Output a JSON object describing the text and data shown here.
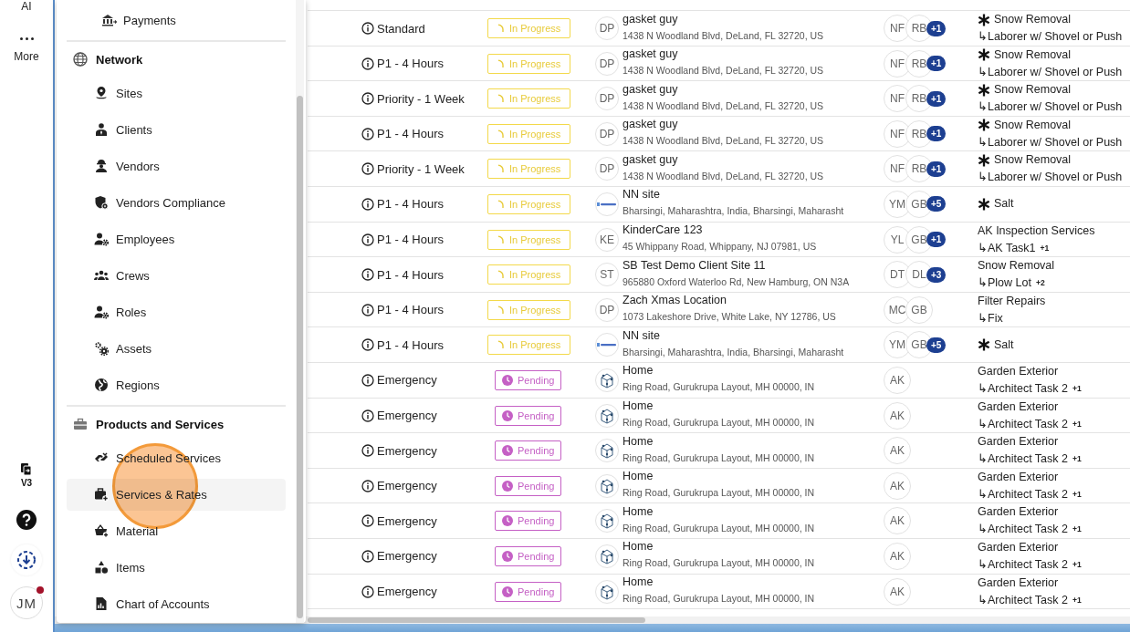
{
  "rail": {
    "items": [
      {
        "label": "AI",
        "kind": "ai"
      },
      {
        "label": "More",
        "kind": "more"
      }
    ],
    "version": "V3",
    "avatar": {
      "initials": "JM",
      "notification": true
    }
  },
  "menu": {
    "items": [
      {
        "label": "Payments",
        "selected": false
      }
    ],
    "sections": [
      {
        "title": "Network",
        "items": [
          {
            "label": "Sites",
            "selected": false
          },
          {
            "label": "Clients",
            "selected": false
          },
          {
            "label": "Vendors",
            "selected": false
          },
          {
            "label": "Vendors Compliance",
            "selected": false
          },
          {
            "label": "Employees",
            "selected": false
          },
          {
            "label": "Crews",
            "selected": false
          },
          {
            "label": "Roles",
            "selected": false
          },
          {
            "label": "Assets",
            "selected": false
          },
          {
            "label": "Regions",
            "selected": false
          }
        ]
      },
      {
        "title": "Products and Services",
        "items": [
          {
            "label": "Scheduled Services",
            "selected": false
          },
          {
            "label": "Services & Rates",
            "selected": true
          },
          {
            "label": "Material",
            "selected": false
          },
          {
            "label": "Items",
            "selected": false
          },
          {
            "label": "Chart of Accounts",
            "selected": false
          }
        ]
      }
    ]
  },
  "table": {
    "rows": [
      {
        "priority": "Standard",
        "status": {
          "label": "In Progress",
          "kind": "in_progress"
        },
        "site": {
          "kind": "initials",
          "initials": "DP",
          "name": "gasket guy",
          "address": "1438 N Woodland Blvd, DeLand, FL 32720, US"
        },
        "vendors": {
          "initials": [
            "NF",
            "RB"
          ],
          "extra": "+1"
        },
        "service": {
          "starred": true,
          "name": "Snow Removal",
          "task": "↳Laborer w/ Shovel or Push"
        }
      },
      {
        "priority": "P1 - 4 Hours",
        "status": {
          "label": "In Progress",
          "kind": "in_progress"
        },
        "site": {
          "kind": "initials",
          "initials": "DP",
          "name": "gasket guy",
          "address": "1438 N Woodland Blvd, DeLand, FL 32720, US"
        },
        "vendors": {
          "initials": [
            "NF",
            "RB"
          ],
          "extra": "+1"
        },
        "service": {
          "starred": true,
          "name": "Snow Removal",
          "task": "↳Laborer w/ Shovel or Push"
        }
      },
      {
        "priority": "Priority - 1 Week",
        "status": {
          "label": "In Progress",
          "kind": "in_progress"
        },
        "site": {
          "kind": "initials",
          "initials": "DP",
          "name": "gasket guy",
          "address": "1438 N Woodland Blvd, DeLand, FL 32720, US"
        },
        "vendors": {
          "initials": [
            "NF",
            "RB"
          ],
          "extra": "+1"
        },
        "service": {
          "starred": true,
          "name": "Snow Removal",
          "task": "↳Laborer w/ Shovel or Push"
        }
      },
      {
        "priority": "P1 - 4 Hours",
        "status": {
          "label": "In Progress",
          "kind": "in_progress"
        },
        "site": {
          "kind": "initials",
          "initials": "DP",
          "name": "gasket guy",
          "address": "1438 N Woodland Blvd, DeLand, FL 32720, US"
        },
        "vendors": {
          "initials": [
            "NF",
            "RB"
          ],
          "extra": "+1"
        },
        "service": {
          "starred": true,
          "name": "Snow Removal",
          "task": "↳Laborer w/ Shovel or Push"
        }
      },
      {
        "priority": "Priority - 1 Week",
        "status": {
          "label": "In Progress",
          "kind": "in_progress"
        },
        "site": {
          "kind": "initials",
          "initials": "DP",
          "name": "gasket guy",
          "address": "1438 N Woodland Blvd, DeLand, FL 32720, US"
        },
        "vendors": {
          "initials": [
            "NF",
            "RB"
          ],
          "extra": "+1"
        },
        "service": {
          "starred": true,
          "name": "Snow Removal",
          "task": "↳Laborer w/ Shovel or Push"
        }
      },
      {
        "priority": "P1 - 4 Hours",
        "status": {
          "label": "In Progress",
          "kind": "in_progress"
        },
        "site": {
          "kind": "brand",
          "name": "NN site",
          "address": "Bharsingi, Maharashtra, India, Bharsingi, Maharasht"
        },
        "vendors": {
          "initials": [
            "YM",
            "GB"
          ],
          "extra": "+5"
        },
        "service": {
          "starred": true,
          "name": "Salt"
        }
      },
      {
        "priority": "P1 - 4 Hours",
        "status": {
          "label": "In Progress",
          "kind": "in_progress"
        },
        "site": {
          "kind": "initials",
          "initials": "KE",
          "name": "KinderCare 123",
          "address": "45 Whippany Road, Whippany, NJ 07981, US"
        },
        "vendors": {
          "initials": [
            "YL",
            "GB"
          ],
          "extra": "+1"
        },
        "service": {
          "starred": false,
          "name": "AK Inspection Services",
          "task": "↳AK Task1",
          "more": "+1"
        }
      },
      {
        "priority": "P1 - 4 Hours",
        "status": {
          "label": "In Progress",
          "kind": "in_progress"
        },
        "site": {
          "kind": "initials",
          "initials": "ST",
          "name": "SB Test Demo Client Site 11",
          "address": "965880 Oxford Waterloo Rd, New Hamburg, ON N3A"
        },
        "vendors": {
          "initials": [
            "DT",
            "DL"
          ],
          "extra": "+3"
        },
        "service": {
          "starred": false,
          "name": "Snow Removal",
          "task": "↳Plow Lot",
          "more": "+2"
        }
      },
      {
        "priority": "P1 - 4 Hours",
        "status": {
          "label": "In Progress",
          "kind": "in_progress"
        },
        "site": {
          "kind": "initials",
          "initials": "DP",
          "name": "Zach Xmas Location",
          "address": "1073 Lakeshore Drive, White Lake, NY 12786, US"
        },
        "vendors": {
          "initials": [
            "MC",
            "GB"
          ]
        },
        "service": {
          "starred": false,
          "name": "Filter Repairs",
          "task": "↳Fix"
        }
      },
      {
        "priority": "P1 - 4 Hours",
        "status": {
          "label": "In Progress",
          "kind": "in_progress"
        },
        "site": {
          "kind": "brand",
          "name": "NN site",
          "address": "Bharsingi, Maharashtra, India, Bharsingi, Maharasht"
        },
        "vendors": {
          "initials": [
            "YM",
            "GB"
          ],
          "extra": "+5"
        },
        "service": {
          "starred": true,
          "name": "Salt"
        }
      },
      {
        "priority": "Emergency",
        "status": {
          "label": "Pending",
          "kind": "pending"
        },
        "site": {
          "kind": "house",
          "name": "Home",
          "address": "Ring Road, Gurukrupa Layout, MH 00000, IN"
        },
        "vendors": {
          "initials": [
            "AK"
          ]
        },
        "service": {
          "starred": false,
          "name": "Garden Exterior",
          "task": "↳Architect Task 2",
          "more": "+1"
        }
      },
      {
        "priority": "Emergency",
        "status": {
          "label": "Pending",
          "kind": "pending"
        },
        "site": {
          "kind": "house",
          "name": "Home",
          "address": "Ring Road, Gurukrupa Layout, MH 00000, IN"
        },
        "vendors": {
          "initials": [
            "AK"
          ]
        },
        "service": {
          "starred": false,
          "name": "Garden Exterior",
          "task": "↳Architect Task 2",
          "more": "+1"
        }
      },
      {
        "priority": "Emergency",
        "status": {
          "label": "Pending",
          "kind": "pending"
        },
        "site": {
          "kind": "house",
          "name": "Home",
          "address": "Ring Road, Gurukrupa Layout, MH 00000, IN"
        },
        "vendors": {
          "initials": [
            "AK"
          ]
        },
        "service": {
          "starred": false,
          "name": "Garden Exterior",
          "task": "↳Architect Task 2",
          "more": "+1"
        }
      },
      {
        "priority": "Emergency",
        "status": {
          "label": "Pending",
          "kind": "pending"
        },
        "site": {
          "kind": "house",
          "name": "Home",
          "address": "Ring Road, Gurukrupa Layout, MH 00000, IN"
        },
        "vendors": {
          "initials": [
            "AK"
          ]
        },
        "service": {
          "starred": false,
          "name": "Garden Exterior",
          "task": "↳Architect Task 2",
          "more": "+1"
        }
      },
      {
        "priority": "Emergency",
        "status": {
          "label": "Pending",
          "kind": "pending"
        },
        "site": {
          "kind": "house",
          "name": "Home",
          "address": "Ring Road, Gurukrupa Layout, MH 00000, IN"
        },
        "vendors": {
          "initials": [
            "AK"
          ]
        },
        "service": {
          "starred": false,
          "name": "Garden Exterior",
          "task": "↳Architect Task 2",
          "more": "+1"
        }
      },
      {
        "priority": "Emergency",
        "status": {
          "label": "Pending",
          "kind": "pending"
        },
        "site": {
          "kind": "house",
          "name": "Home",
          "address": "Ring Road, Gurukrupa Layout, MH 00000, IN"
        },
        "vendors": {
          "initials": [
            "AK"
          ]
        },
        "service": {
          "starred": false,
          "name": "Garden Exterior",
          "task": "↳Architect Task 2",
          "more": "+1"
        }
      },
      {
        "priority": "Emergency",
        "status": {
          "label": "Pending",
          "kind": "pending"
        },
        "site": {
          "kind": "house",
          "name": "Home",
          "address": "Ring Road, Gurukrupa Layout, MH 00000, IN"
        },
        "vendors": {
          "initials": [
            "AK"
          ]
        },
        "service": {
          "starred": false,
          "name": "Garden Exterior",
          "task": "↳Architect Task 2",
          "more": "+1"
        }
      }
    ]
  }
}
